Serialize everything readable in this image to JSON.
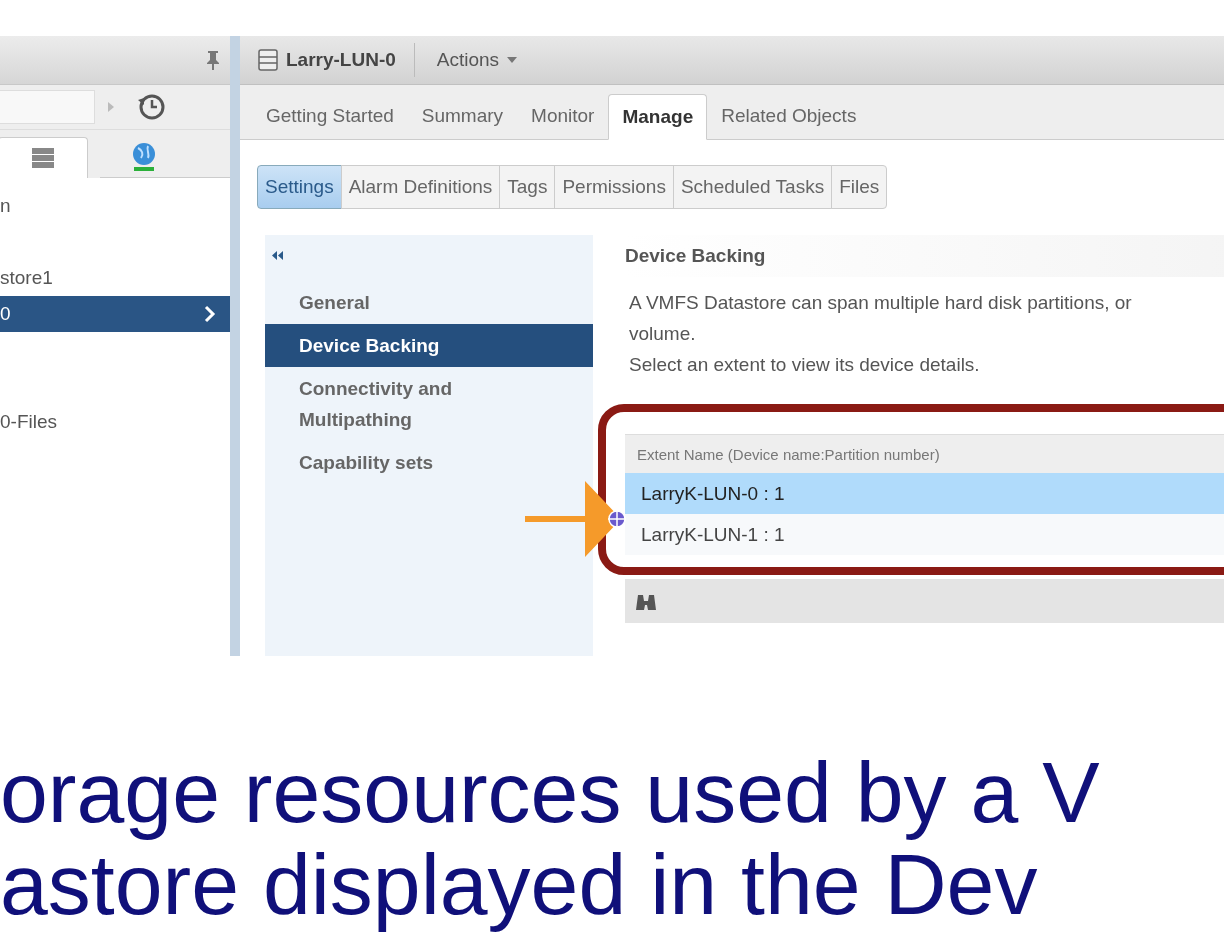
{
  "sidebar": {
    "tabs": [
      {
        "kind": "storage",
        "selected": true
      },
      {
        "kind": "network",
        "selected": false
      }
    ],
    "tree": [
      {
        "label": "n",
        "selected": false
      },
      {
        "label": "store1",
        "selected": false
      },
      {
        "label": "0",
        "selected": true
      },
      {
        "label": "0-Files",
        "selected": false
      }
    ]
  },
  "object": {
    "title": "Larry-LUN-0",
    "actions": "Actions"
  },
  "tabs": [
    {
      "label": "Getting Started",
      "selected": false
    },
    {
      "label": "Summary",
      "selected": false
    },
    {
      "label": "Monitor",
      "selected": false
    },
    {
      "label": "Manage",
      "selected": true
    },
    {
      "label": "Related Objects",
      "selected": false
    }
  ],
  "subtabs": [
    {
      "label": "Settings",
      "selected": true
    },
    {
      "label": "Alarm Definitions",
      "selected": false
    },
    {
      "label": "Tags",
      "selected": false
    },
    {
      "label": "Permissions",
      "selected": false
    },
    {
      "label": "Scheduled Tasks",
      "selected": false
    },
    {
      "label": "Files",
      "selected": false
    }
  ],
  "nav": [
    {
      "label": "General",
      "selected": false
    },
    {
      "label": "Device Backing",
      "selected": true
    },
    {
      "label": "Connectivity and\nMultipathing",
      "selected": false
    },
    {
      "label": "Capability sets",
      "selected": false
    }
  ],
  "section": {
    "title": "Device Backing",
    "description": "A VMFS Datastore can span multiple hard disk partitions, or\nvolume.\nSelect an extent to view its device details."
  },
  "extents": {
    "column": "Extent Name (Device name:Partition number)",
    "rows": [
      {
        "name": "LarryK-LUN-0 : 1",
        "selected": true
      },
      {
        "name": "LarryK-LUN-1 : 1",
        "selected": false
      }
    ]
  },
  "caption": "orage resources used by a V\nastore displayed in the Dev"
}
